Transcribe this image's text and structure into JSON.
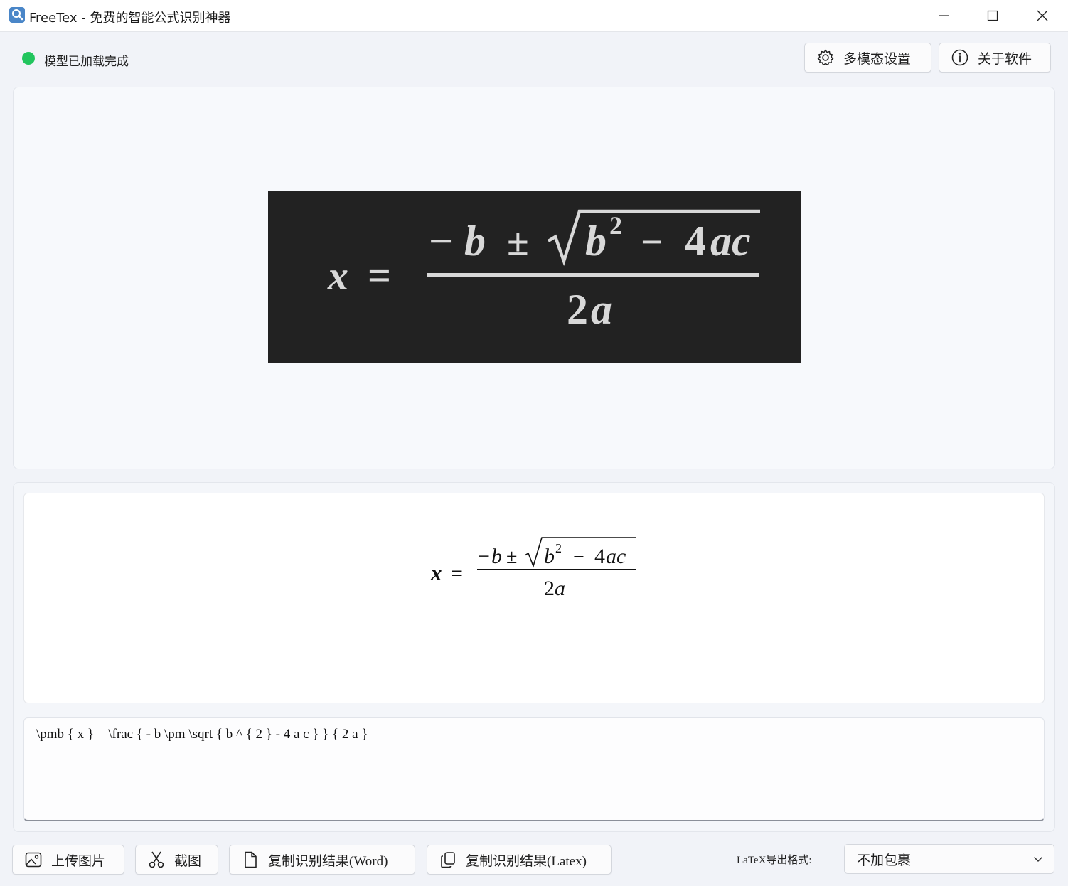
{
  "window": {
    "title": "FreeTex - 免费的智能公式识别神器",
    "controls": [
      "minimize",
      "maximize",
      "close"
    ]
  },
  "status": {
    "text": "模型已加载完成",
    "color": "#22c55e"
  },
  "header_buttons": {
    "settings_label": "多模态设置",
    "about_label": "关于软件"
  },
  "input_image": {
    "formula_text": "x = (−b ± √(b² − 4ac)) / 2a",
    "background": "#222222"
  },
  "result": {
    "rendered_formula": "x = (−b ± √(b² − 4ac)) / 2a",
    "latex": "\\pmb { x } = \\frac { - b \\pm \\sqrt { b ^ { 2 } - 4 a c } } { 2 a }"
  },
  "toolbar": {
    "upload_label": "上传图片",
    "screenshot_label": "截图",
    "copy_word_label": "复制识别结果(Word)",
    "copy_latex_label": "复制识别结果(Latex)",
    "export_format_label": "LaTeX导出格式:",
    "export_format_value": "不加包裹"
  },
  "icons": {
    "app": "app-magnifier-icon",
    "settings": "gear-icon",
    "about": "info-icon",
    "upload": "image-icon",
    "screenshot": "scissors-icon",
    "copy_word": "document-icon",
    "copy_latex": "copy-icon",
    "dropdown": "chevron-down-icon"
  }
}
